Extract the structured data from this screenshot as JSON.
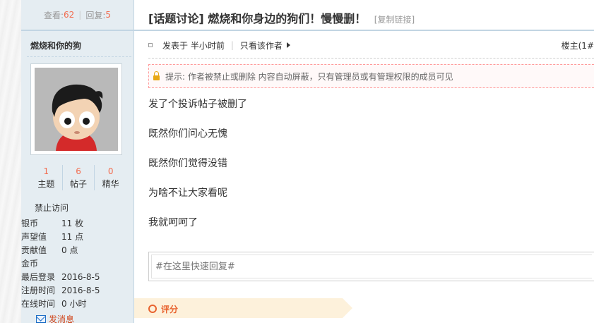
{
  "sidebar": {
    "views_label": "查看:",
    "views_count": "62",
    "replies_label": "回复:",
    "replies_count": "5",
    "username": "燃烧和你的狗",
    "stats": [
      {
        "value": "1",
        "label": "主题"
      },
      {
        "value": "6",
        "label": "帖子"
      },
      {
        "value": "0",
        "label": "精华"
      }
    ],
    "group": "禁止访问",
    "info": [
      {
        "key": "银币",
        "value": "11 枚"
      },
      {
        "key": "声望值",
        "value": "11 点"
      },
      {
        "key": "贡献值",
        "value": "0 点"
      },
      {
        "key": "金币",
        "value": ""
      },
      {
        "key": "最后登录",
        "value": "2016-8-5"
      },
      {
        "key": "注册时间",
        "value": "2016-8-5"
      },
      {
        "key": "在线时间",
        "value": "0 小时"
      }
    ],
    "send_message": "发消息"
  },
  "post": {
    "title": "[话题讨论] 燃烧和你身边的狗们！慢慢删！",
    "copy_link": "[复制链接]",
    "posted": "发表于 半小时前",
    "only_author": "只看该作者",
    "floor": "楼主(1#",
    "notice": "提示: 作者被禁止或删除 内容自动屏蔽，只有管理员或有管理权限的成员可见",
    "lines": [
      "发了个投诉帖子被删了",
      "既然你们问心无愧",
      "既然你们觉得没错",
      "为啥不让大家看呢",
      "我就呵呵了"
    ]
  },
  "reply": {
    "placeholder": "#在这里快速回复#"
  },
  "rating": {
    "label": "评分"
  },
  "colors": {
    "accent": "#f26c4f",
    "sidebar_bg": "#e5edf2",
    "border": "#c2d5e3",
    "rating_bg": "#fdf1db"
  }
}
